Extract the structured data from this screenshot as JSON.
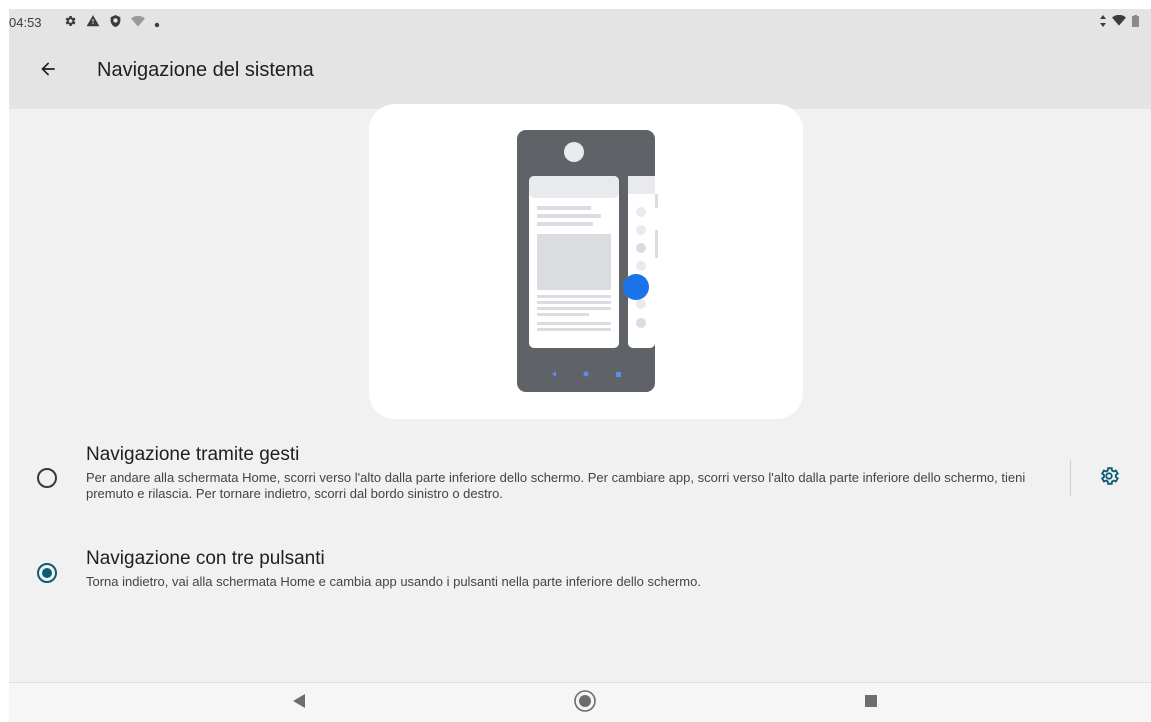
{
  "status_bar": {
    "time": "04:53",
    "icons": [
      "settings-icon",
      "warning-icon",
      "shield-icon",
      "wifi-question-icon",
      "dot-icon"
    ],
    "right_icons": [
      "data-arrows-icon",
      "wifi-icon",
      "battery-icon"
    ]
  },
  "app_bar": {
    "back_icon": "back-arrow-icon",
    "title": "Navigazione del sistema"
  },
  "illustration": {
    "description_icon": "gesture-navigation-illustration",
    "accent_color": "#1a73e8"
  },
  "options": [
    {
      "id": "gestures",
      "title": "Navigazione tramite gesti",
      "description": "Per andare alla schermata Home, scorri verso l'alto dalla parte inferiore dello schermo. Per cambiare app, scorri verso l'alto dalla parte inferiore dello schermo, tieni premuto e rilascia. Per tornare indietro, scorri dal bordo sinistro o destro.",
      "selected": false,
      "settings_icon": "gear-icon"
    },
    {
      "id": "three_buttons",
      "title": "Navigazione con tre pulsanti",
      "description": "Torna indietro, vai alla schermata Home e cambia app usando i pulsanti nella parte inferiore dello schermo.",
      "selected": true
    }
  ],
  "nav_bar": {
    "buttons": [
      "nav-back-icon",
      "nav-home-icon",
      "nav-recents-icon"
    ]
  },
  "colors": {
    "radio_selected": "#0b5c73",
    "gear_icon": "#0b5c73",
    "header_bg": "#e4e4e4",
    "screen_bg": "#f1f1f1"
  }
}
